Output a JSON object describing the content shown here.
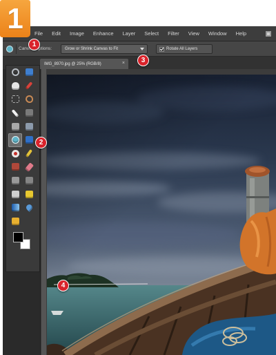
{
  "badge": {
    "number": "1"
  },
  "menu": {
    "items": [
      "File",
      "Edit",
      "Image",
      "Enhance",
      "Layer",
      "Select",
      "Filter",
      "View",
      "Window",
      "Help"
    ],
    "workspace_icon": "workspace-icon"
  },
  "options_bar": {
    "tool_icon": "straighten-icon",
    "canvas_label": "Canvas Options:",
    "canvas_select_value": "Grow or Shrink Canvas to Fit",
    "rotate_all_layers_label": "Rotate All Layers",
    "rotate_all_layers_checked": true
  },
  "document": {
    "tab_title": "IMG_8970.jpg @ 25% (RGB/8)",
    "close_glyph": "×"
  },
  "toolbox": {
    "tools": [
      {
        "icon": "zoom-icon",
        "color": "#b8bec4"
      },
      {
        "icon": "move-icon",
        "color": "#3f7fcf"
      },
      {
        "icon": "hand-icon",
        "color": "#e6e6e6"
      },
      {
        "icon": "eyedropper-icon",
        "color": "#d8423a"
      },
      {
        "icon": "marquee-icon",
        "color": "#9a9a9a"
      },
      {
        "icon": "lasso-icon",
        "color": "#c98a55"
      },
      {
        "icon": "magic-wand-icon",
        "color": "#f2f2f2"
      },
      {
        "icon": "quick-selection-icon",
        "color": "#7a7a7a"
      },
      {
        "icon": "crop-icon",
        "color": "#a8a8a8"
      },
      {
        "icon": "cookie-cutter-icon",
        "color": "#8c9aab"
      },
      {
        "icon": "straighten-icon",
        "color": "#5fb4c8",
        "selected": true
      },
      {
        "icon": "recompose-icon",
        "color": "#2f6fc7"
      },
      {
        "icon": "red-eye-icon",
        "color": "#c8302a"
      },
      {
        "icon": "pencil-icon",
        "color": "#e3c23a"
      },
      {
        "icon": "spot-healing-icon",
        "color": "#b0483a"
      },
      {
        "icon": "eraser-icon",
        "color": "#e07a8a"
      },
      {
        "icon": "brush-icon",
        "color": "#9a9a9a"
      },
      {
        "icon": "smart-brush-icon",
        "color": "#858585"
      },
      {
        "icon": "clone-stamp-icon",
        "color": "#d0d0d0"
      },
      {
        "icon": "paint-bucket-icon",
        "color": "#e8c830"
      },
      {
        "icon": "gradient-icon",
        "color": "#3d8fd8"
      },
      {
        "icon": "blur-icon",
        "color": "#5a9ad8"
      },
      {
        "icon": "custom-shape-icon",
        "color": "#e8b030"
      }
    ],
    "foreground_color": "#000000",
    "background_color": "#ffffff"
  },
  "callouts": [
    "1",
    "2",
    "3",
    "4"
  ],
  "theme": {
    "badge": "#f0891d",
    "callout": "#d9232b",
    "ui_panel": "#3b3b3b",
    "menu_text": "#d8d8d8"
  }
}
